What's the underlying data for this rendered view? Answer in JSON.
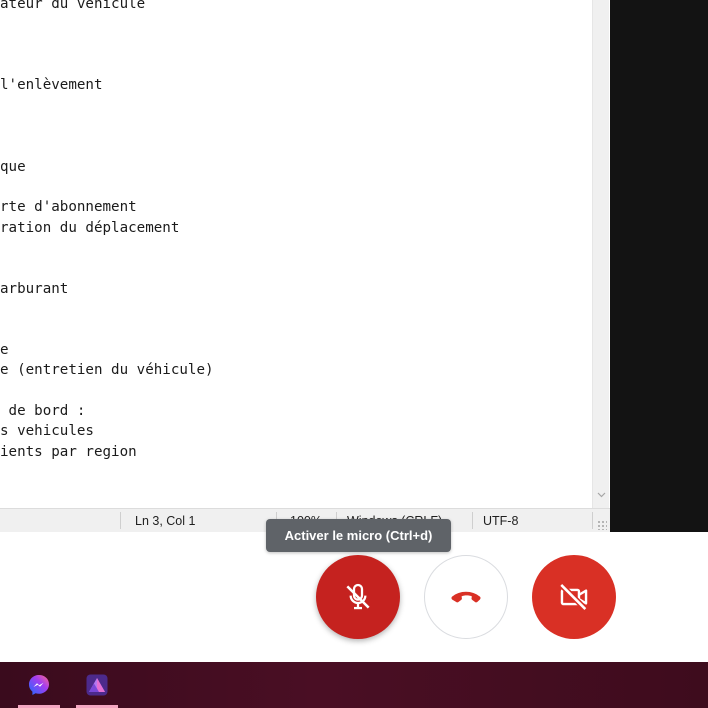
{
  "editor": {
    "lines": [
      "ateur du véhicule",
      "",
      "",
      "",
      "l'enlèvement",
      "",
      "",
      "",
      "que",
      "",
      "rte d'abonnement",
      "ration du déplacement",
      "",
      "",
      "arburant",
      "",
      "",
      "e",
      "e (entretien du véhicule)",
      "",
      " de bord :",
      "s vehicules",
      "ients par region"
    ]
  },
  "statusbar": {
    "position": "Ln 3, Col 1",
    "zoom": "100%",
    "line_ending": "Windows (CRLF)",
    "encoding": "UTF-8"
  },
  "controls": {
    "tooltip": "Activer le micro (Ctrl+d)",
    "mic_button_icon": "mic-off-icon",
    "hangup_button_icon": "phone-hangup-icon",
    "camera_button_icon": "camera-off-icon",
    "colors": {
      "mic_button": "#c5221f",
      "camera_button": "#d93025",
      "hangup_icon": "#d93025"
    }
  },
  "taskbar": {
    "apps": [
      {
        "icon": "messenger-icon"
      },
      {
        "icon": "affinity-photo-icon"
      }
    ]
  }
}
